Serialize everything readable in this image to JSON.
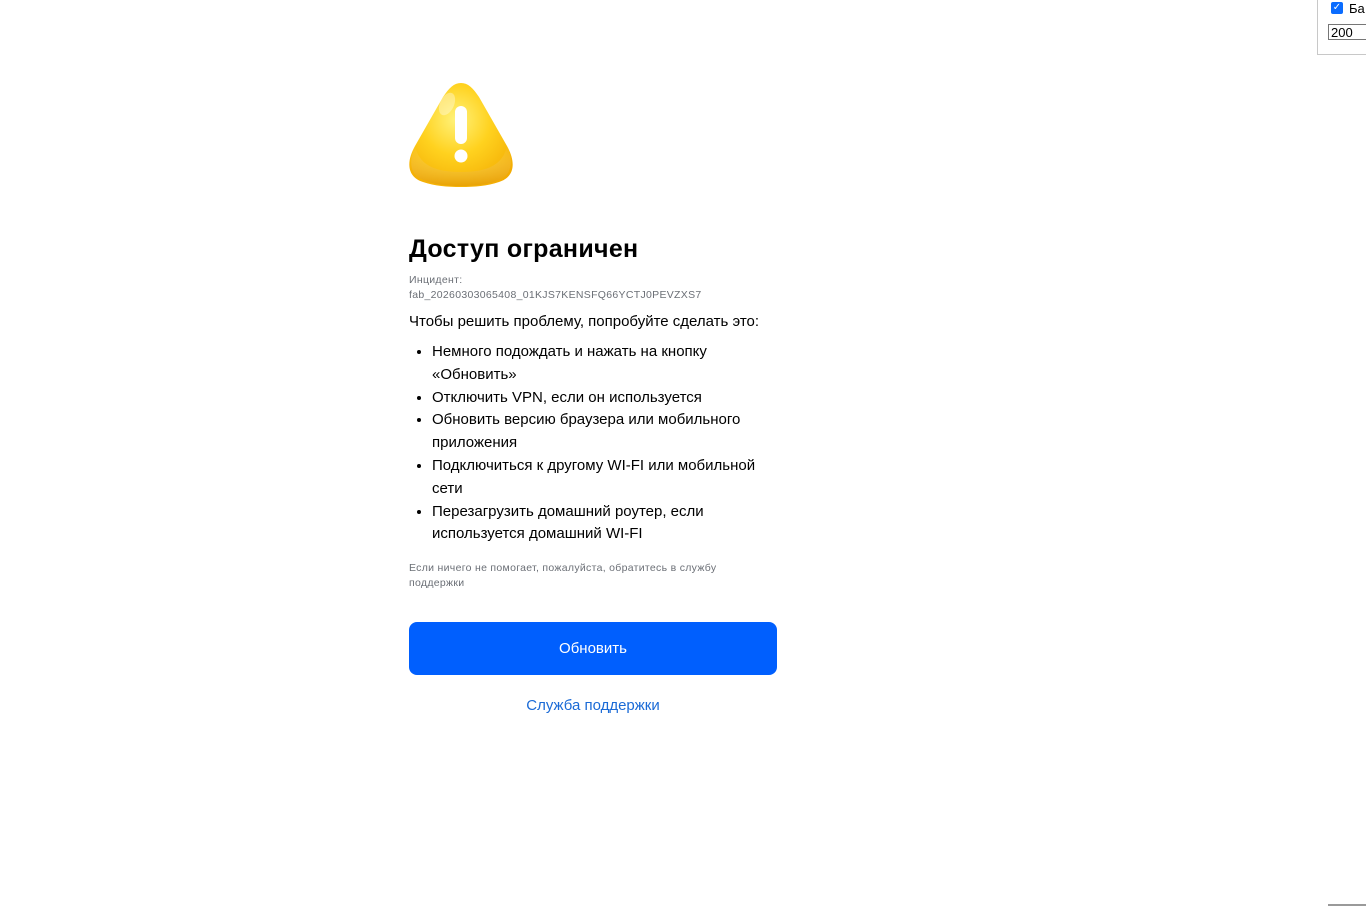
{
  "debug_panel": {
    "checkbox_label": "Ба",
    "checkbox_checked": true,
    "input_value": "200"
  },
  "page": {
    "icon": "warning-triangle-icon",
    "title": "Доступ ограничен",
    "incident_label": "Инцидент:",
    "incident_id": "fab_20260303065408_01KJS7KENSFQ66YCTJ0PEVZXS7",
    "intro": "Чтобы решить проблему, попробуйте сделать это:",
    "tips": [
      "Немного подождать и нажать на кнопку «Обновить»",
      "Отключить VPN, если он используется",
      "Обновить версию браузера или мобильного приложения",
      "Подключиться к другому WI-FI или мобильной сети",
      "Перезагрузить домашний роутер, если используется домашний WI-FI"
    ],
    "note": "Если ничего не помогает, пожалуйста, обратитесь в службу поддержки",
    "refresh_button": "Обновить",
    "support_link": "Служба поддержки"
  },
  "colors": {
    "primary_button": "#005ffe",
    "link": "#1a6ad6",
    "muted_text": "#6b6f76",
    "warning_yellow": "#ffc107"
  }
}
